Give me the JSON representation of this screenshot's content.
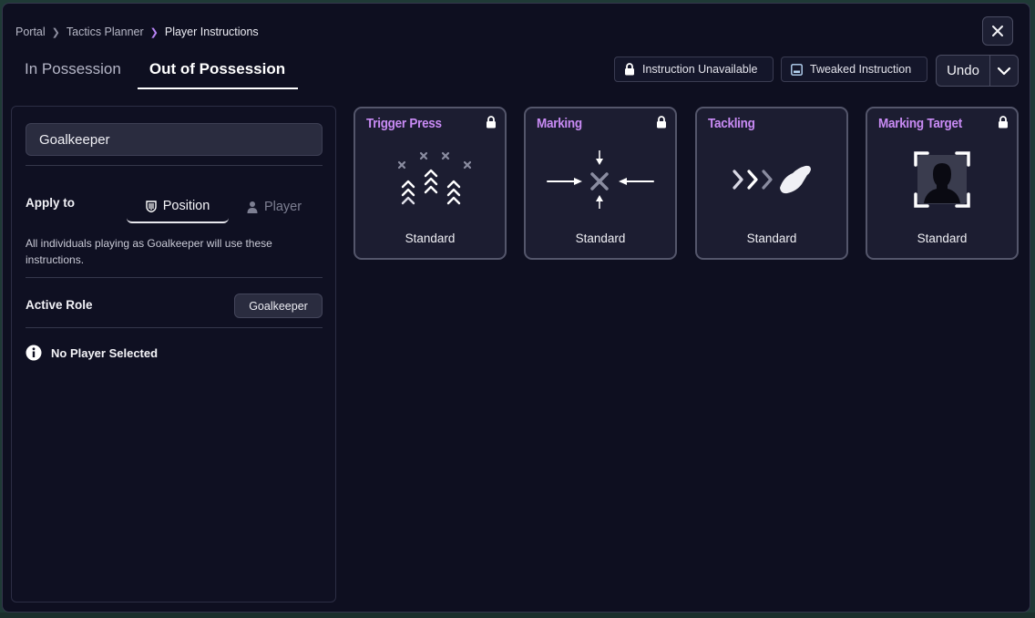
{
  "breadcrumb": [
    "Portal",
    "Tactics Planner",
    "Player Instructions"
  ],
  "tabs": [
    {
      "label": "In Possession",
      "active": false
    },
    {
      "label": "Out of Possession",
      "active": true
    }
  ],
  "legend": {
    "unavailable": "Instruction Unavailable",
    "tweaked": "Tweaked Instruction"
  },
  "undo": {
    "label": "Undo"
  },
  "sidebar": {
    "role_field": "Goalkeeper",
    "apply_to_label": "Apply to",
    "apply_options": [
      {
        "label": "Position",
        "icon": "shield-icon",
        "selected": true
      },
      {
        "label": "Player",
        "icon": "person-icon",
        "selected": false
      }
    ],
    "description": "All individuals playing as Goalkeeper will use these instructions.",
    "active_role_label": "Active Role",
    "active_role_value": "Goalkeeper",
    "no_player": "No Player Selected"
  },
  "cards": [
    {
      "title": "Trigger Press",
      "locked": true,
      "icon": "trigger-press-icon",
      "value": "Standard"
    },
    {
      "title": "Marking",
      "locked": true,
      "icon": "marking-icon",
      "value": "Standard"
    },
    {
      "title": "Tackling",
      "locked": false,
      "icon": "tackling-icon",
      "value": "Standard"
    },
    {
      "title": "Marking Target",
      "locked": true,
      "icon": "marking-target-icon",
      "value": "Standard"
    }
  ],
  "colors": {
    "accent": "#c98bf5",
    "background": "#0e0f20",
    "card": "#1c1d31"
  }
}
